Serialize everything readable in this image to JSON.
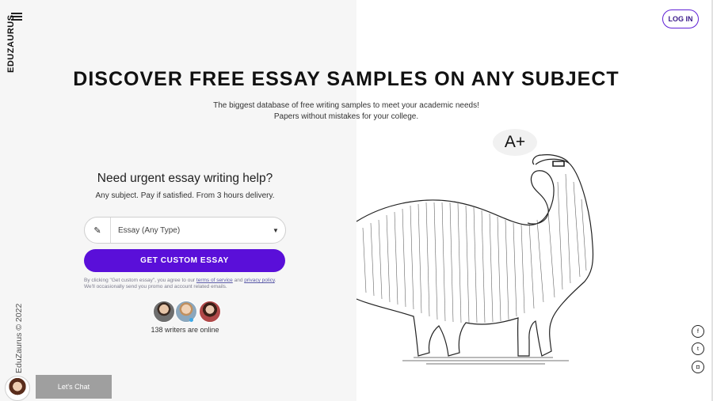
{
  "brand": "EDUZAURUS",
  "copyright": "EduZaurus © 2022",
  "header": {
    "login_label": "LOG IN"
  },
  "hero": {
    "title": "DISCOVER FREE ESSAY SAMPLES ON ANY SUBJECT",
    "subtitle_line1": "The biggest database of free writing samples to meet your academic needs!",
    "subtitle_line2": "Papers without mistakes for your college."
  },
  "order": {
    "heading": "Need urgent essay writing help?",
    "subheading": "Any subject. Pay if satisfied. From 3 hours delivery.",
    "select_value": "Essay (Any Type)",
    "cta_label": "GET CUSTOM ESSAY",
    "disclaimer_prefix": "By clicking \"Get custom essay\", you agree to our ",
    "terms_link": "terms of service",
    "disclaimer_mid": " and ",
    "privacy_link": "privacy policy",
    "disclaimer_suffix": ". We'll occasionally send you promo and account related emails.",
    "online_text": "138 writers are online"
  },
  "chat": {
    "label": "Let's Chat"
  },
  "illustration": {
    "grade": "A+"
  },
  "social": {
    "facebook": "f",
    "twitter": "t",
    "instagram": "◘"
  },
  "colors": {
    "accent": "#5a0fd9",
    "panel": "#f6f6f6"
  }
}
